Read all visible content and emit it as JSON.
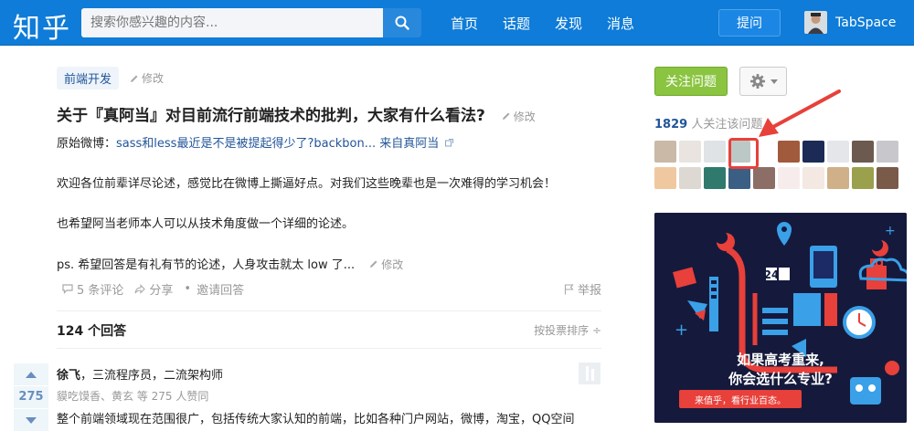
{
  "header": {
    "logo": "知乎",
    "search_placeholder": "搜索你感兴趣的内容...",
    "nav": [
      "首页",
      "话题",
      "发现",
      "消息"
    ],
    "ask_label": "提问",
    "username": "TabSpace"
  },
  "question": {
    "topic": "前端开发",
    "edit_label": "修改",
    "title": "关于『真阿当』对目前流行前端技术的批判，大家有什么看法?",
    "weibo_prefix": "原始微博：",
    "weibo_link": "sass和less最近是不是被提起得少了?backbon... 来自真阿当",
    "paragraphs": [
      "欢迎各位前辈详尽论述，感觉比在微博上撕逼好点。对我们这些晚辈也是一次难得的学习机会！",
      "也希望阿当老师本人可以从技术角度做一个详细的论述。",
      "ps. 希望回答是有礼有节的论述，人身攻击就太 low 了..."
    ],
    "actions": {
      "comments": "5 条评论",
      "share": "分享",
      "dot": "•",
      "invite": "邀请回答",
      "report": "举报"
    },
    "answer_count": "124 个回答",
    "sort_label": "按投票排序 ÷"
  },
  "answer": {
    "votes": "275",
    "author": "徐飞",
    "author_bio": "，三流程序员，二流架构师",
    "likers": "貘吃馍香、黄玄 等 275 人赞同",
    "text": "整个前端领域现在范围很广，包括传统大家认知的前端，比如各种门户网站，微博，淘宝，QQ空间"
  },
  "sidebar": {
    "follow_label": "关注问题",
    "followers_count": "1829",
    "followers_text": " 人关注该问题",
    "avatar_colors": [
      "#c9b9a6",
      "#e9e4e0",
      "#dfe3e6",
      "#bcc8c6",
      "#ffffff",
      "#a25a3c",
      "#1c2b56",
      "#e4e6ea",
      "#6c5a50",
      "#c8c8cc",
      "#f0c8a0",
      "#ded8d2",
      "#2f7a6c",
      "#3b5f84",
      "#8c6e66",
      "#f7ecec",
      "#f3e8e2",
      "#d0b088",
      "#9aa04c",
      "#7a5a48"
    ],
    "ad": {
      "line1": "如果高考重来,",
      "line2": "你会选什么专业?",
      "pill": "来值乎，看行业百态。",
      "clock_label": "24"
    }
  }
}
